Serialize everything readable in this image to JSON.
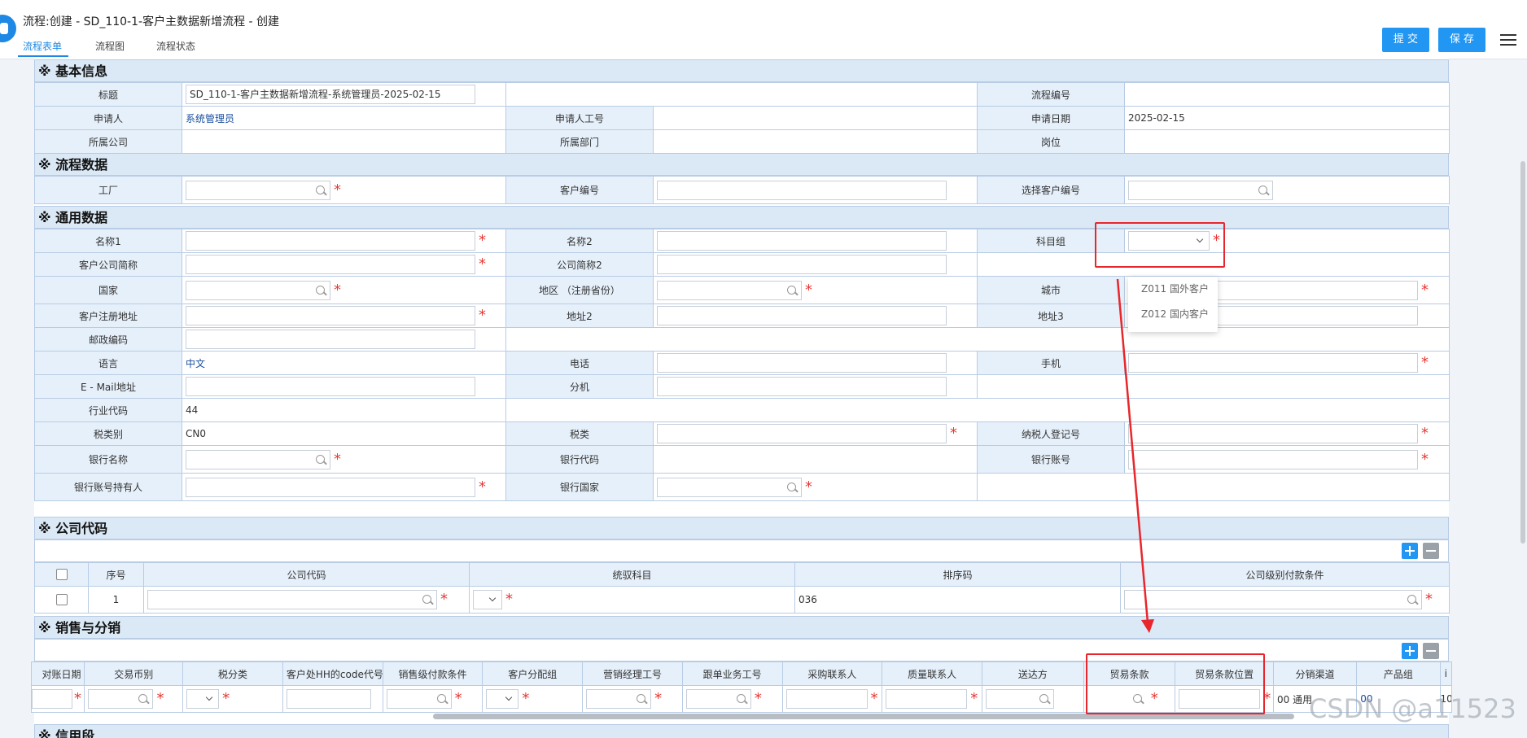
{
  "header": {
    "title": "流程:创建 - SD_110-1-客户主数据新增流程 - 创建",
    "tabs": [
      "流程表单",
      "流程图",
      "流程状态"
    ],
    "submit_label": "提 交",
    "save_label": "保 存"
  },
  "sections": {
    "basic": "※ 基本信息",
    "process": "※ 流程数据",
    "general": "※ 通用数据",
    "company": "※ 公司代码",
    "sales": "※ 销售与分销",
    "credit": "※ 信用段"
  },
  "basic": {
    "title_label": "标题",
    "title_value": "SD_110-1-客户主数据新增流程-系统管理员-2025-02-15",
    "flow_no_label": "流程编号",
    "applicant_label": "申请人",
    "applicant_value": "系统管理员",
    "applicant_id_label": "申请人工号",
    "apply_date_label": "申请日期",
    "apply_date_value": "2025-02-15",
    "company_label": "所属公司",
    "dept_label": "所属部门",
    "post_label": "岗位"
  },
  "process": {
    "factory_label": "工厂",
    "cust_no_label": "客户编号",
    "select_cust_label": "选择客户编号"
  },
  "general": {
    "name1": "名称1",
    "name2": "名称2",
    "account_group": "科目组",
    "short_name": "客户公司简称",
    "short_name2": "公司简称2",
    "country": "国家",
    "region": "地区 （注册省份）",
    "city": "城市",
    "reg_addr": "客户注册地址",
    "addr2": "地址2",
    "addr3": "地址3",
    "postcode": "邮政编码",
    "language": "语言",
    "language_value": "中文",
    "phone": "电话",
    "mobile": "手机",
    "email": "E - Mail地址",
    "ext": "分机",
    "industry": "行业代码",
    "industry_value": "44",
    "tax_class": "税类别",
    "tax_class_value": "CN0",
    "tax_type": "税类",
    "taxpayer": "纳税人登记号",
    "bank_name": "银行名称",
    "bank_code": "银行代码",
    "bank_account": "银行账号",
    "account_holder": "银行账号持有人",
    "bank_country": "银行国家"
  },
  "account_group_options": [
    "Z011 国外客户",
    "Z012 国内客户"
  ],
  "company_table": {
    "headers": [
      "序号",
      "公司代码",
      "统驭科目",
      "排序码",
      "公司级别付款条件"
    ],
    "row": {
      "seq": "1",
      "sort_code": "036"
    }
  },
  "sales_table": {
    "headers": [
      "对账日期",
      "交易币别",
      "税分类",
      "客户处HH的code代号",
      "销售级付款条件",
      "客户分配组",
      "营销经理工号",
      "跟单业务工号",
      "采购联系人",
      "质量联系人",
      "送达方",
      "贸易条款",
      "贸易条款位置",
      "分销渠道",
      "产品组",
      "i"
    ],
    "channel_value": "00 通用",
    "product_group_value": "00",
    "last_value": "10"
  },
  "watermark": "CSDN @a11523",
  "colors": {
    "accent": "#2196f3",
    "label_bg": "#e6f0fa",
    "section_bg": "#dbe9f6",
    "required": "#e53935",
    "highlight": "#e8262b"
  }
}
